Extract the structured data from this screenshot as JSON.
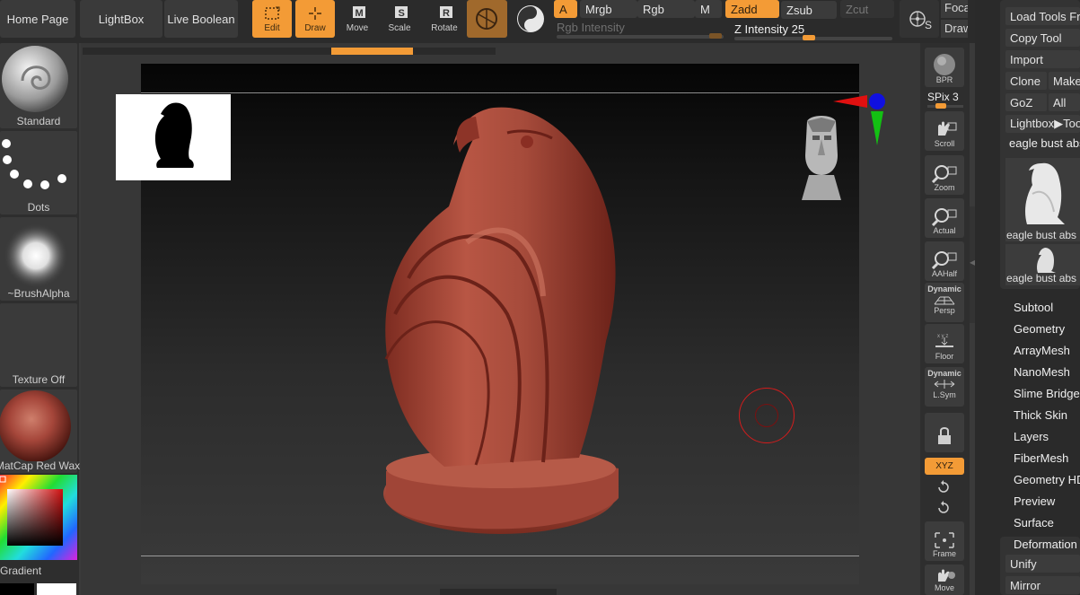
{
  "top_nav": {
    "home_page": "Home Page",
    "lightbox": "LightBox",
    "live_boolean": "Live Boolean"
  },
  "tools": {
    "edit": "Edit",
    "draw": "Draw",
    "move": "Move",
    "scale": "Scale",
    "rotate": "Rotate"
  },
  "channels": {
    "a": "A",
    "mrgb": "Mrgb",
    "rgb": "Rgb",
    "m": "M",
    "zadd": "Zadd",
    "zsub": "Zsub",
    "zcut": "Zcut"
  },
  "rgb_intensity": {
    "label": "Rgb Intensity"
  },
  "z_intensity": {
    "label": "Z Intensity",
    "value": "25"
  },
  "focal": {
    "label": "Foca",
    "draw": "Draw"
  },
  "sym_label": "S",
  "left_shelf": {
    "brush": "Standard",
    "stroke": "Dots",
    "alpha": "~BrushAlpha",
    "texture": "Texture Off",
    "material": "MatCap Red Wax",
    "gradient": "Gradient"
  },
  "right_tools": {
    "bpr": "BPR",
    "spix_label": "SPix",
    "spix_value": "3",
    "scroll": "Scroll",
    "zoom": "Zoom",
    "actual": "Actual",
    "aahalf": "AAHalf",
    "persp_top": "Dynamic",
    "persp": "Persp",
    "floor": "Floor",
    "lsym_top": "Dynamic",
    "lsym": "L.Sym",
    "xyz": "XYZ",
    "frame": "Frame",
    "move": "Move"
  },
  "tool_panel": {
    "load_tools": "Load Tools Fro",
    "copy_tool": "Copy Tool",
    "import": "Import",
    "clone": "Clone",
    "make": "Make",
    "goz": "GoZ",
    "all": "All",
    "lightbox_tools": "Lightbox▶Too",
    "tool_name": "eagle bust abs",
    "thumb1_label": "eagle bust abs",
    "thumb2_label": "eagle bust abs",
    "menu": [
      "Subtool",
      "Geometry",
      "ArrayMesh",
      "NanoMesh",
      "Slime Bridge",
      "Thick Skin",
      "Layers",
      "FiberMesh",
      "Geometry HD",
      "Preview",
      "Surface"
    ],
    "deformation": "Deformation",
    "unify": "Unify",
    "mirror": "Mirror"
  },
  "colors": {
    "accent": "#f39b36",
    "material": "#a5463a",
    "panel": "#2b2b2b"
  }
}
